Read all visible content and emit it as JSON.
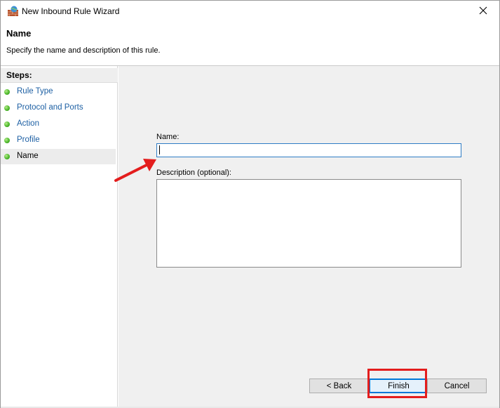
{
  "window": {
    "title": "New Inbound Rule Wizard",
    "app_icon": "firewall-icon",
    "close_icon": "close-icon"
  },
  "header": {
    "title": "Name",
    "description": "Specify the name and description of this rule."
  },
  "steps": {
    "heading": "Steps:",
    "items": [
      {
        "label": "Rule Type",
        "active": false
      },
      {
        "label": "Protocol and Ports",
        "active": false
      },
      {
        "label": "Action",
        "active": false
      },
      {
        "label": "Profile",
        "active": false
      },
      {
        "label": "Name",
        "active": true
      }
    ]
  },
  "form": {
    "name_label": "Name:",
    "name_value": "",
    "description_label": "Description (optional):",
    "description_value": ""
  },
  "buttons": {
    "back": "< Back",
    "finish": "Finish",
    "cancel": "Cancel"
  },
  "annotations": {
    "arrow_color": "#e31d1d",
    "highlight_color": "#e31d1d"
  }
}
